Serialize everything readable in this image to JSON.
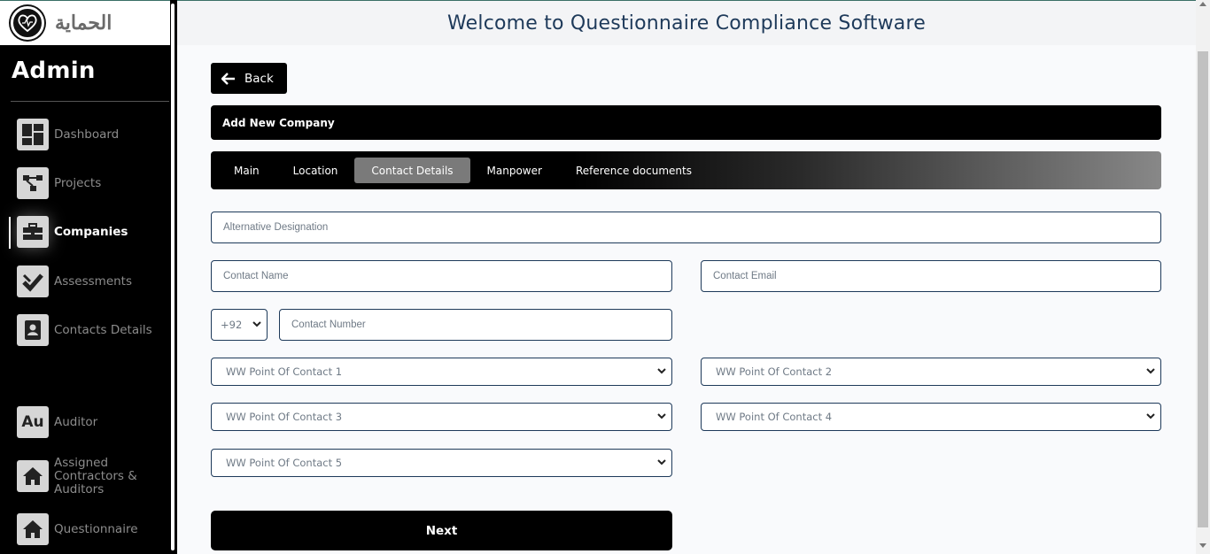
{
  "app": {
    "logo_text": "الحماية",
    "header_title": "Welcome to Questionnaire Compliance Software"
  },
  "sidebar": {
    "role_title": "Admin",
    "items": [
      {
        "label": "Dashboard",
        "icon": "dashboard-icon"
      },
      {
        "label": "Projects",
        "icon": "projects-icon"
      },
      {
        "label": "Companies",
        "icon": "briefcase-icon",
        "active": true
      },
      {
        "label": "Assessments",
        "icon": "check-icon"
      },
      {
        "label": "Contacts Details",
        "icon": "contact-book-icon"
      },
      {
        "label": "Auditor",
        "icon": "au-icon",
        "icon_text": "Au"
      },
      {
        "label": "Assigned Contractors & Auditors",
        "icon": "home-icon"
      },
      {
        "label": "Questionnaire",
        "icon": "home-icon"
      }
    ]
  },
  "page": {
    "back_label": "Back",
    "card_title": "Add New Company",
    "tabs": [
      {
        "label": "Main"
      },
      {
        "label": "Location"
      },
      {
        "label": "Contact Details",
        "active": true
      },
      {
        "label": "Manpower"
      },
      {
        "label": "Reference documents"
      }
    ],
    "form": {
      "alternative_designation_placeholder": "Alternative Designation",
      "contact_name_placeholder": "Contact Name",
      "contact_email_placeholder": "Contact Email",
      "country_code": "+92",
      "contact_number_placeholder": "Contact Number",
      "poc_1": "WW Point Of Contact 1",
      "poc_2": "WW Point Of Contact 2",
      "poc_3": "WW Point Of Contact 3",
      "poc_4": "WW Point Of Contact 4",
      "poc_5": "WW Point Of Contact 5"
    },
    "next_label": "Next"
  },
  "colors": {
    "sidebar_bg": "#000000",
    "active_tab_bg": "#7a7a7a",
    "field_border": "#1e3a5a",
    "header_text": "#1e3a5a"
  }
}
